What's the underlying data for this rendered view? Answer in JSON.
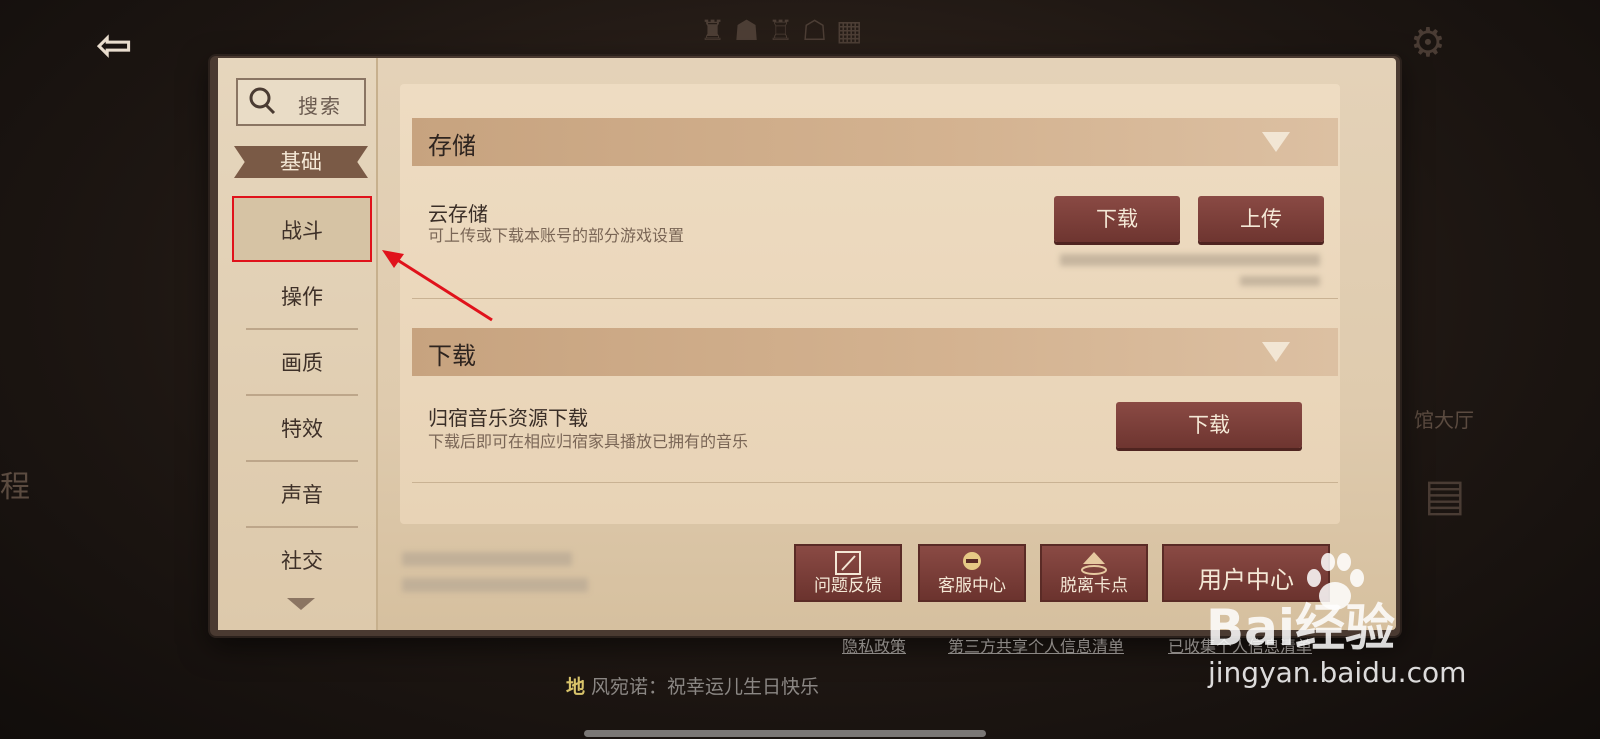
{
  "search": {
    "label": "搜索"
  },
  "nav": {
    "category": "基础",
    "items": [
      {
        "label": "战斗",
        "selected": true
      },
      {
        "label": "操作"
      },
      {
        "label": "画质"
      },
      {
        "label": "特效"
      },
      {
        "label": "声音"
      },
      {
        "label": "社交"
      }
    ]
  },
  "background": {
    "side_left": "程",
    "side_right": "馆大厅"
  },
  "sections": {
    "storage": {
      "title": "存储",
      "row_title": "云存储",
      "row_desc": "可上传或下载本账号的部分游戏设置",
      "download_label": "下载",
      "upload_label": "上传"
    },
    "download": {
      "title": "下载",
      "row_title": "归宿音乐资源下载",
      "row_desc": "下载后即可在相应归宿家具播放已拥有的音乐",
      "download_label": "下载"
    }
  },
  "actions": [
    {
      "label": "问题反馈",
      "icon": "pen-icon"
    },
    {
      "label": "客服中心",
      "icon": "agent-icon"
    },
    {
      "label": "脱离卡点",
      "icon": "upload-icon"
    },
    {
      "label": "用户中心"
    }
  ],
  "links": [
    "隐私政策",
    "第三方共享个人信息清单",
    "已收集个人信息清单"
  ],
  "ticker": {
    "tag": "地",
    "text": "风宛诺：祝幸运儿生日快乐"
  },
  "watermark": {
    "brand": "Bai经验",
    "url": "jingyan.baidu.com"
  },
  "colors": {
    "button": "#7a3e38",
    "panel": "#e4d2b8",
    "highlight": "#e0121b"
  }
}
